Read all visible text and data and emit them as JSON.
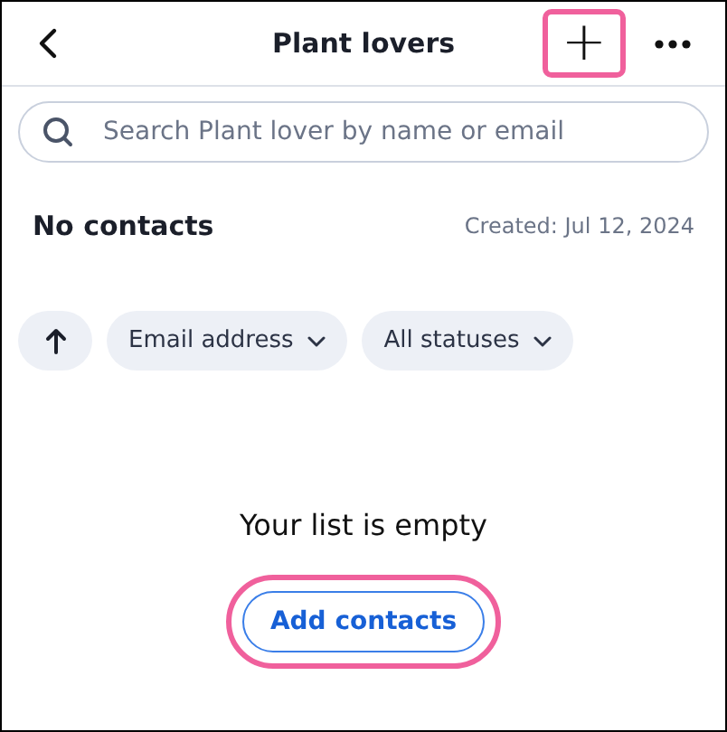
{
  "header": {
    "title": "Plant lovers",
    "add_button": {
      "label": "+",
      "highlighted": true
    }
  },
  "search": {
    "placeholder": "Search Plant lover by name or email"
  },
  "summary": {
    "count": "No contacts",
    "created": "Created: Jul 12, 2024"
  },
  "filters": [
    {
      "kind": "sort"
    },
    {
      "kind": "dropdown",
      "label": "Email address"
    },
    {
      "kind": "dropdown",
      "label": "All statuses"
    }
  ],
  "empty_state": {
    "message": "Your list is empty",
    "button": {
      "label": "Add contacts",
      "highlighted": true
    }
  }
}
